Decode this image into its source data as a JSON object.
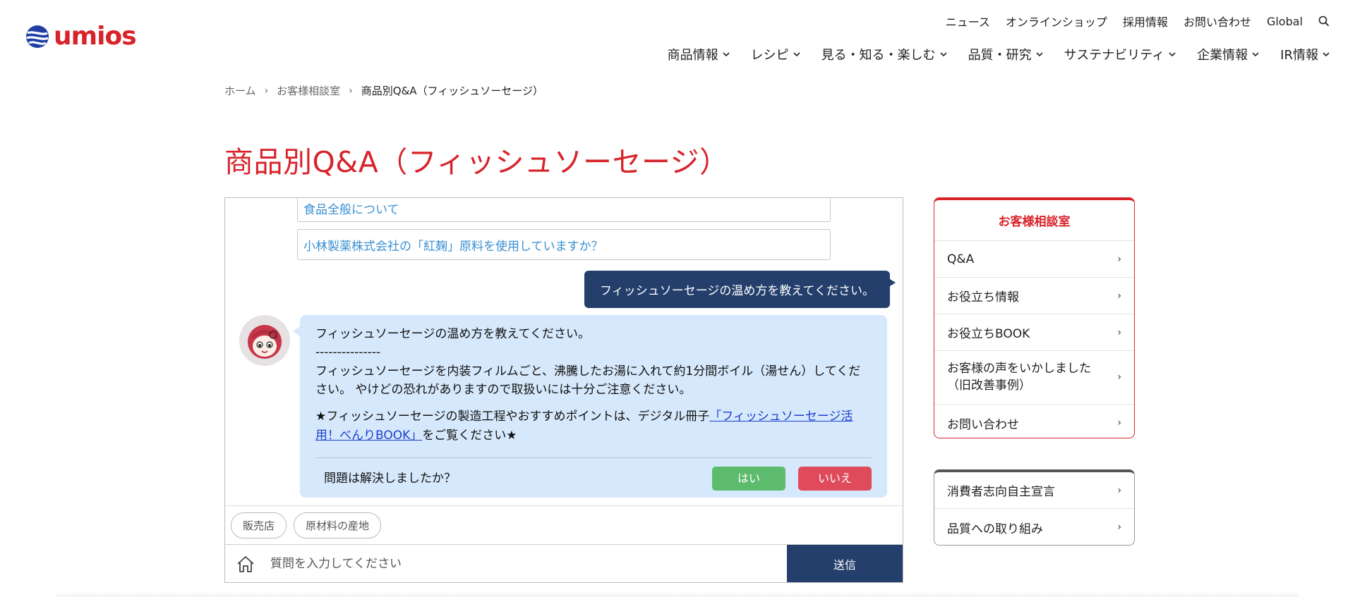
{
  "header": {
    "logo_text": "umios",
    "util_nav": [
      "ニュース",
      "オンラインショップ",
      "採用情報",
      "お問い合わせ",
      "Global"
    ],
    "main_nav": [
      "商品情報",
      "レシピ",
      "見る・知る・楽しむ",
      "品質・研究",
      "サステナビリティ",
      "企業情報",
      "IR情報"
    ]
  },
  "breadcrumb": {
    "home": "ホーム",
    "section": "お客様相談室",
    "current": "商品別Q&A（フィッシュソーセージ）"
  },
  "page_title": "商品別Q&A（フィッシュソーセージ）",
  "chat": {
    "suggestions": [
      "食品全般について",
      "小林製薬株式会社の「紅麹」原料を使用していますか？"
    ],
    "user_message": "フィッシュソーセージの温め方を教えてください。",
    "bot": {
      "question": "フィッシュソーセージの温め方を教えてください。",
      "divider": "---------------",
      "answer": "フィッシュソーセージを内装フィルムごと、沸騰したお湯に入れて約1分間ボイル（湯せん）してください。 やけどの恐れがありますので取扱いには十分ご注意ください。",
      "note_prefix": "★フィッシュソーセージの製造工程やおすすめポイントは、デジタル冊子",
      "note_link": "「フィッシュソーセージ活用！べんりBOOK」",
      "note_suffix": "をご覧ください★",
      "feedback_question": "問題は解決しましたか？",
      "yes_label": "はい",
      "no_label": "いいえ"
    },
    "chips": [
      "販売店",
      "原材料の産地"
    ],
    "input_placeholder": "質問を入力してください",
    "send_label": "送信"
  },
  "sidebar": {
    "heading": "お客様相談室",
    "items": [
      "Q&A",
      "お役立ち情報",
      "お役立ちBOOK",
      "お客様の声をいかしました（旧改善事例）",
      "お問い合わせ"
    ],
    "items2": [
      "消費者志向自主宣言",
      "品質への取り組み"
    ]
  },
  "colors": {
    "brand_red": "#d8232a",
    "navy": "#243f6b",
    "bot_bubble": "#d6e8fb",
    "link_blue": "#3a8fd1",
    "yes_green": "#5dbb6e",
    "no_red": "#e04b5c"
  }
}
